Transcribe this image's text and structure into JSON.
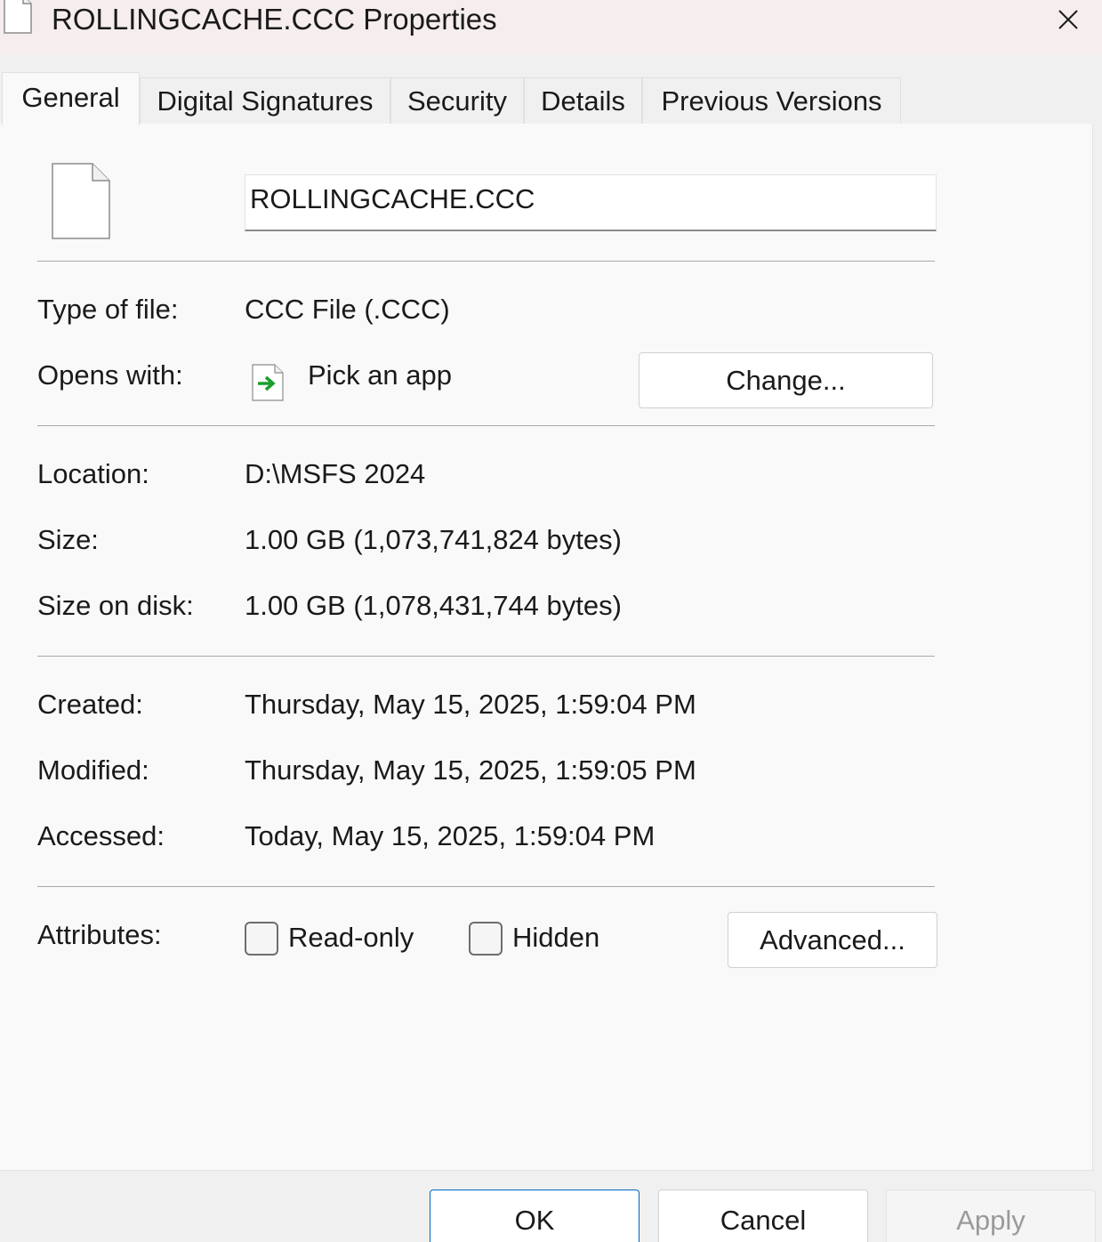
{
  "window": {
    "title": "ROLLINGCACHE.CCC Properties",
    "icon": "file-icon",
    "close_icon": "close-icon"
  },
  "tabs": [
    {
      "label": "General",
      "active": true
    },
    {
      "label": "Digital Signatures",
      "active": false
    },
    {
      "label": "Security",
      "active": false
    },
    {
      "label": "Details",
      "active": false
    },
    {
      "label": "Previous Versions",
      "active": false
    }
  ],
  "general": {
    "file_name": "ROLLINGCACHE.CCC",
    "type_label": "Type of file:",
    "type_value": "CCC File (.CCC)",
    "opens_label": "Opens with:",
    "opens_value": "Pick an app",
    "change_button": "Change...",
    "location_label": "Location:",
    "location_value": "D:\\MSFS 2024",
    "size_label": "Size:",
    "size_value": "1.00 GB (1,073,741,824 bytes)",
    "size_on_disk_label": "Size on disk:",
    "size_on_disk_value": "1.00 GB (1,078,431,744 bytes)",
    "created_label": "Created:",
    "created_value": "Thursday, May 15, 2025, 1:59:04 PM",
    "modified_label": "Modified:",
    "modified_value": "Thursday, May 15, 2025, 1:59:05 PM",
    "accessed_label": "Accessed:",
    "accessed_value": "Today, May 15, 2025, 1:59:04 PM",
    "attributes_label": "Attributes:",
    "readonly_label": "Read-only",
    "readonly_checked": false,
    "hidden_label": "Hidden",
    "hidden_checked": false,
    "advanced_button": "Advanced..."
  },
  "footer": {
    "ok": "OK",
    "cancel": "Cancel",
    "apply": "Apply"
  },
  "colors": {
    "accent": "#0067c0",
    "title_bar": "#f6eeee",
    "arrow_green": "#1a9e2c"
  }
}
